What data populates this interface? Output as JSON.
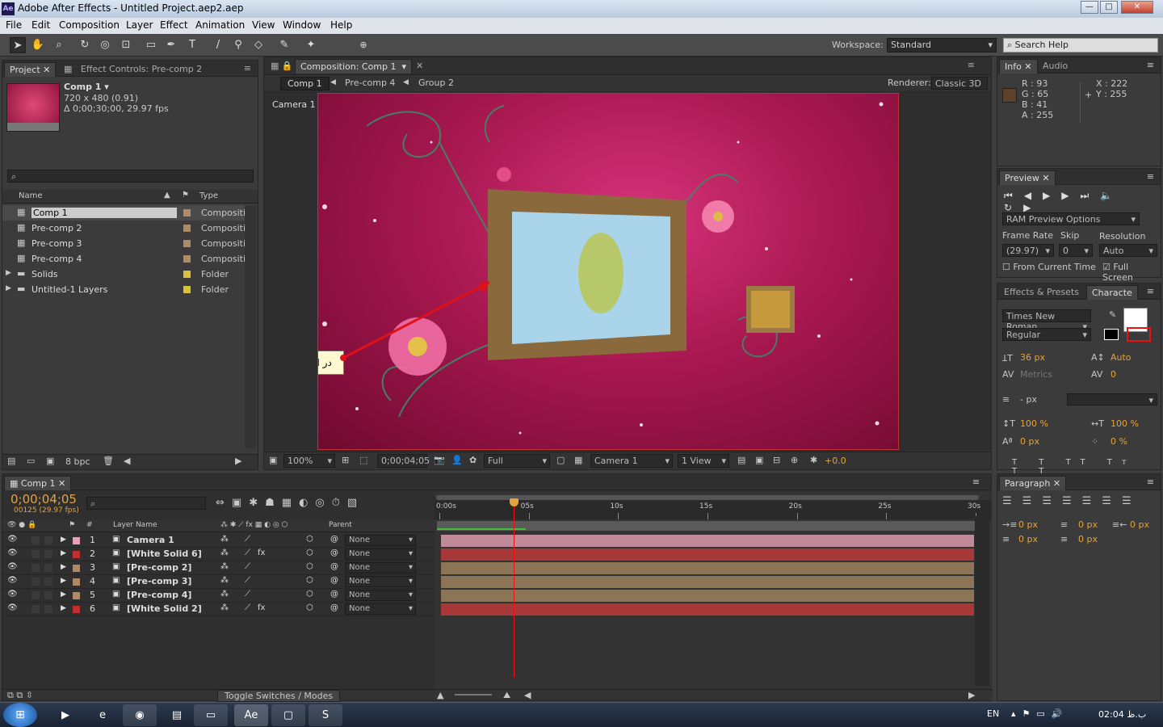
{
  "window": {
    "title": "Adobe After Effects - Untitled Project.aep2.aep",
    "app_icon": "Ae",
    "min": "—",
    "max": "□",
    "close": "✕"
  },
  "menu": [
    "File",
    "Edit",
    "Composition",
    "Layer",
    "Effect",
    "Animation",
    "View",
    "Window",
    "Help"
  ],
  "toolbar": {
    "workspace_label": "Workspace:",
    "workspace_value": "Standard",
    "search_placeholder": "Search Help"
  },
  "project": {
    "tab_project": "Project",
    "tab_effect": "Effect Controls: Pre-comp 2",
    "comp_name": "Comp 1 ▾",
    "comp_size": "720 x 480 (0.91)",
    "comp_dur": "Δ 0;00;30;00, 29.97 fps",
    "search_icon": "⌕",
    "col_name": "Name",
    "col_type": "Type",
    "items": [
      {
        "name": "Comp 1",
        "type": "Compositio",
        "color": "#b08a66",
        "kind": "comp"
      },
      {
        "name": "Pre-comp 2",
        "type": "Compositio",
        "color": "#b08a66",
        "kind": "comp"
      },
      {
        "name": "Pre-comp 3",
        "type": "Compositio",
        "color": "#b08a66",
        "kind": "comp"
      },
      {
        "name": "Pre-comp 4",
        "type": "Compositio",
        "color": "#b08a66",
        "kind": "comp"
      },
      {
        "name": "Solids",
        "type": "Folder",
        "color": "#d9c13a",
        "kind": "folder"
      },
      {
        "name": "Untitled-1 Layers",
        "type": "Folder",
        "color": "#d9c13a",
        "kind": "folder"
      }
    ],
    "bpc": "8 bpc"
  },
  "comp": {
    "tab": "Composition: Comp 1",
    "crumbs": [
      "Comp 1",
      "Pre-comp 4",
      "Group 2"
    ],
    "renderer_label": "Renderer:",
    "renderer": "Classic 3D",
    "camera_label": "Camera 1",
    "annotation": "در اینجا حالت سه بعدی قاب از بین رفته است",
    "footer": {
      "zoom": "100%",
      "timecode": "0;00;04;05",
      "res": "Full",
      "camera": "Camera 1",
      "view": "1 View",
      "exposure": "+0.0"
    }
  },
  "info": {
    "tab_info": "Info",
    "tab_audio": "Audio",
    "r": "R : 93",
    "g": "G : 65",
    "b": "B : 41",
    "a": "A : 255",
    "x": "X : 222",
    "y": "Y : 255",
    "swatch": "#5d4129"
  },
  "preview": {
    "tab": "Preview",
    "ram": "RAM Preview Options",
    "frame_rate_label": "Frame Rate",
    "skip_label": "Skip",
    "resolution_label": "Resolution",
    "frame_rate": "(29.97)",
    "skip": "0",
    "resolution": "Auto",
    "from_current": "From Current Time",
    "full_screen": "Full Screen"
  },
  "character": {
    "tab_effects": "Effects & Presets",
    "tab_char": "Characte",
    "font": "Times New Roman",
    "style": "Regular",
    "size": "36 px",
    "leading": "Auto",
    "kerning": "Metrics",
    "tracking": "0",
    "stroke": "- px",
    "vscale": "100 %",
    "hscale": "100 %",
    "baseline": "0 px",
    "tsume": "0 %"
  },
  "paragraph": {
    "tab": "Paragraph",
    "indent_left": "0 px",
    "indent_first": "0 px",
    "indent_right": "0 px",
    "space_before": "0 px",
    "space_after": "0 px"
  },
  "timeline": {
    "tab": "Comp 1",
    "timecode": "0;00;04;05",
    "frames": "00125 (29.97 fps)",
    "col_layer": "Layer Name",
    "col_parent": "Parent",
    "hash": "#",
    "toggle": "Toggle Switches / Modes",
    "ruler": [
      "0:00s",
      "05s",
      "10s",
      "15s",
      "20s",
      "25s",
      "30s"
    ],
    "playhead_seconds": 4.17,
    "duration_seconds": 30,
    "layers": [
      {
        "num": "1",
        "name": "Camera 1",
        "label": "#e8a0b4",
        "bar": "#c08a98",
        "parent": "None",
        "fx": false
      },
      {
        "num": "2",
        "name": "[White Solid 6]",
        "label": "#c03030",
        "bar": "#a83838",
        "parent": "None",
        "fx": true
      },
      {
        "num": "3",
        "name": "[Pre-comp 2]",
        "label": "#b08a66",
        "bar": "#8c7456",
        "parent": "None",
        "fx": false
      },
      {
        "num": "4",
        "name": "[Pre-comp 3]",
        "label": "#b08a66",
        "bar": "#8c7456",
        "parent": "None",
        "fx": false
      },
      {
        "num": "5",
        "name": "[Pre-comp 4]",
        "label": "#b08a66",
        "bar": "#8c7456",
        "parent": "None",
        "fx": false
      },
      {
        "num": "6",
        "name": "[White Solid 2]",
        "label": "#c03030",
        "bar": "#a83838",
        "parent": "None",
        "fx": true
      }
    ]
  },
  "taskbar": {
    "lang": "EN",
    "clock": "02:04 ب.ظ"
  }
}
